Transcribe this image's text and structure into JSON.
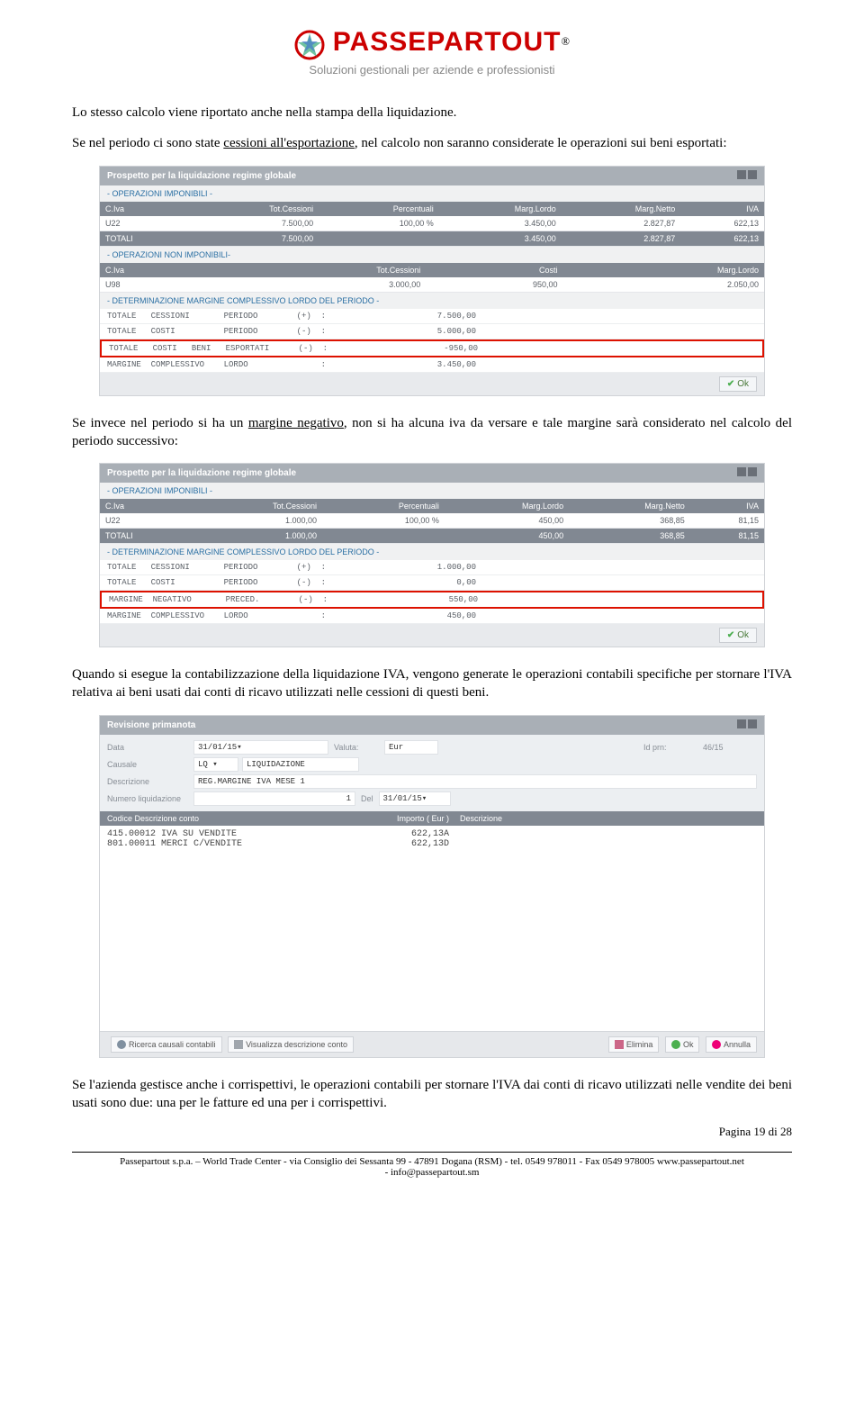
{
  "header": {
    "brand": "PASSEPARTOUT",
    "brand_sup": "®",
    "subtitle": "Soluzioni gestionali per aziende e professionisti"
  },
  "body": {
    "p1": "Lo stesso calcolo viene riportato anche nella stampa della liquidazione.",
    "p2a": "Se nel periodo ci sono state ",
    "p2u": "cessioni all'esportazione",
    "p2b": ", nel calcolo non saranno considerate le operazioni sui beni esportati:",
    "p3a": "Se invece nel periodo si ha un ",
    "p3u": "margine negativo",
    "p3b": ", non si ha alcuna iva da versare e tale margine sarà considerato nel calcolo del periodo successivo:",
    "p4": "Quando si esegue la contabilizzazione della liquidazione IVA, vengono generate le operazioni contabili specifiche per stornare l'IVA relativa ai beni usati dai conti di ricavo utilizzati nelle cessioni di questi beni.",
    "p5": "Se l'azienda gestisce anche i corrispettivi, le operazioni contabili per stornare l'IVA dai conti di ricavo utilizzati nelle vendite dei beni usati sono due: una per le fatture ed una per i corrispettivi."
  },
  "panel1": {
    "title": "Prospetto per la liquidazione regime globale",
    "sec1": "- OPERAZIONI IMPONIBILI -",
    "th": [
      "C.Iva",
      "Tot.Cessioni",
      "Percentuali",
      "Marg.Lordo",
      "Marg.Netto",
      "IVA"
    ],
    "row1": [
      "U22",
      "7.500,00",
      "100,00 %",
      "3.450,00",
      "2.827,87",
      "622,13"
    ],
    "rowT": [
      "TOTALI",
      "7.500,00",
      "",
      "3.450,00",
      "2.827,87",
      "622,13"
    ],
    "sec2": "- OPERAZIONI NON IMPONIBILI-",
    "th2": [
      "C.Iva",
      "Tot.Cessioni",
      "Costi",
      "Marg.Lordo"
    ],
    "row2": [
      "U98",
      "3.000,00",
      "950,00",
      "2.050,00"
    ],
    "sec3": "- DETERMINAZIONE MARGINE COMPLESSIVO LORDO DEL PERIODO -",
    "calc": [
      {
        "lab": "TOTALE   CESSIONI       PERIODO        (+)  :",
        "val": "7.500,00",
        "red": false
      },
      {
        "lab": "TOTALE   COSTI          PERIODO        (-)  :",
        "val": "5.000,00",
        "red": false
      },
      {
        "lab": "TOTALE   COSTI   BENI   ESPORTATI      (-)  :",
        "val": "-950,00",
        "red": true
      },
      {
        "lab": "MARGINE  COMPLESSIVO    LORDO               :",
        "val": "3.450,00",
        "red": false
      }
    ],
    "ok": "Ok"
  },
  "panel2": {
    "title": "Prospetto per la liquidazione regime globale",
    "sec1": "- OPERAZIONI IMPONIBILI -",
    "th": [
      "C.Iva",
      "Tot.Cessioni",
      "Percentuali",
      "Marg.Lordo",
      "Marg.Netto",
      "IVA"
    ],
    "row1": [
      "U22",
      "1.000,00",
      "100,00 %",
      "450,00",
      "368,85",
      "81,15"
    ],
    "rowT": [
      "TOTALI",
      "1.000,00",
      "",
      "450,00",
      "368,85",
      "81,15"
    ],
    "sec3": "- DETERMINAZIONE MARGINE COMPLESSIVO LORDO DEL PERIODO -",
    "calc": [
      {
        "lab": "TOTALE   CESSIONI       PERIODO        (+)  :",
        "val": "1.000,00",
        "red": false
      },
      {
        "lab": "TOTALE   COSTI          PERIODO        (-)  :",
        "val": "0,00",
        "red": false
      },
      {
        "lab": "MARGINE  NEGATIVO       PRECED.        (-)  :",
        "val": "550,00",
        "red": true
      },
      {
        "lab": "MARGINE  COMPLESSIVO    LORDO               :",
        "val": "450,00",
        "red": false
      }
    ],
    "ok": "Ok"
  },
  "panel3": {
    "title": "Revisione primanota",
    "labels": {
      "data": "Data",
      "valuta": "Valuta:",
      "idprn": "Id prn:",
      "causale": "Causale",
      "descr": "Descrizione",
      "numliq": "Numero liquidazione",
      "del": "Del"
    },
    "fields": {
      "data": "31/01/15▾",
      "valuta": "Eur",
      "idprn": "46/15",
      "causale_code": "LQ ▾",
      "causale_text": "LIQUIDAZIONE",
      "descr": "REG.MARGINE IVA MESE 1",
      "numliq": "1",
      "del": "31/01/15▾"
    },
    "jr_head": [
      "Codice Descrizione conto",
      "Importo   ( Eur )",
      "Descrizione"
    ],
    "journal": [
      {
        "acct": "415.00012 IVA SU VENDITE",
        "amt": "622,13A"
      },
      {
        "acct": "801.00011 MERCI C/VENDITE",
        "amt": "622,13D"
      }
    ],
    "toolbar": {
      "left1": "Ricerca causali contabili",
      "left2": "Visualizza descrizione conto",
      "elimina": "Elimina",
      "ok": "Ok",
      "annulla": "Annulla"
    }
  },
  "footer": {
    "page": "Pagina 19 di 28",
    "line1": "Passepartout s.p.a. – World Trade Center - via Consiglio dei Sessanta 99 - 47891 Dogana (RSM) - tel. 0549 978011 - Fax 0549 978005 www.passepartout.net",
    "line2": "- info@passepartout.sm"
  }
}
